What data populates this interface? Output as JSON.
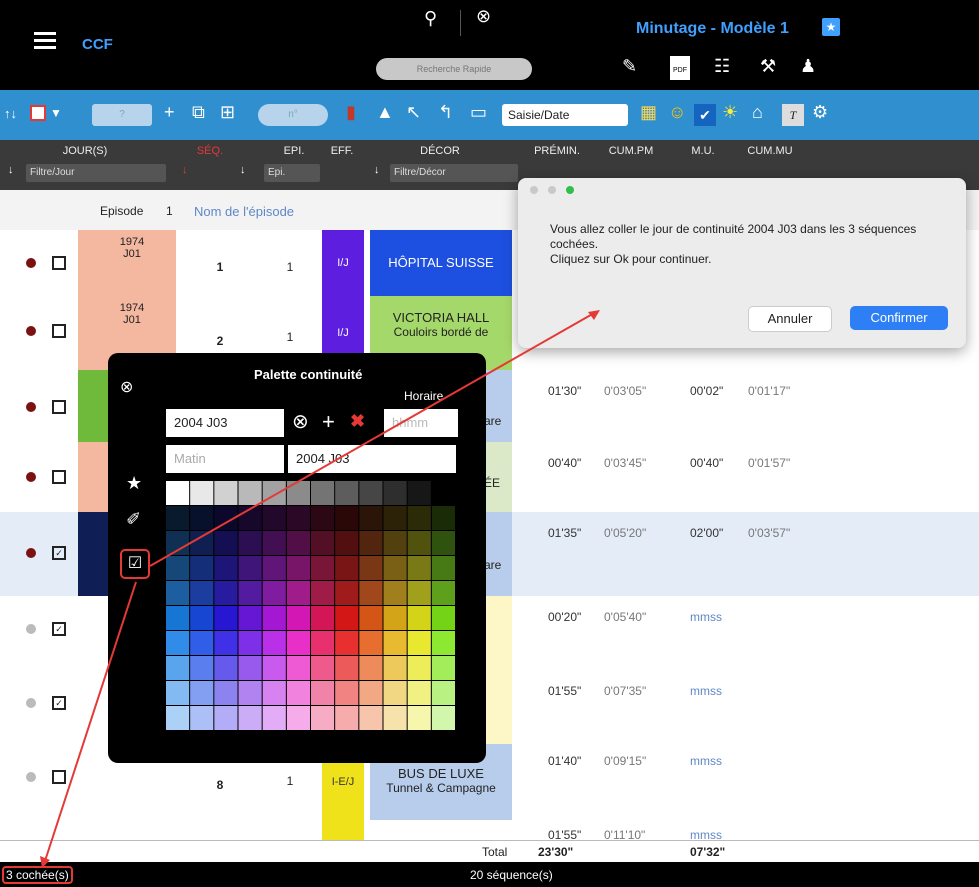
{
  "app": {
    "name": "CCF",
    "document_title": "Minutage - Modèle 1"
  },
  "search": {
    "placeholder": "Recherche Rapide"
  },
  "toolbar": {
    "saisie_label": "Saisie/Date",
    "episode_field": "?",
    "no_field": "n°"
  },
  "columns": {
    "jour": "JOUR(S)",
    "jour_filter": "Filtre/Jour",
    "seq": "SÉQ.",
    "epi": "EPI.",
    "epi_filter": "Epi.",
    "eff": "EFF.",
    "decor": "DÉCOR",
    "decor_filter": "Filtre/Décor",
    "premin": "PRÉMIN.",
    "cumpm": "CUM.PM",
    "mu": "M.U.",
    "cummu": "CUM.MU"
  },
  "episode": {
    "label": "Episode",
    "number": "1",
    "name_placeholder": "Nom de l'épisode"
  },
  "rows": [
    {
      "jour": "1974\nJ01",
      "seq": "1",
      "epi": "1",
      "eff": "I/J",
      "decor": "HÔPITAL SUISSE",
      "decor2": "",
      "premin": "",
      "cumpm": "",
      "mu": "",
      "cummu": ""
    },
    {
      "jour": "1974\nJ01",
      "seq": "2",
      "epi": "1",
      "eff": "I/J",
      "decor": "VICTORIA HALL",
      "decor2": "Couloirs bordé de",
      "premin": "",
      "cumpm": "",
      "mu": "",
      "cummu": ""
    },
    {
      "decor_tail": "are",
      "premin": "01'30\"",
      "cumpm": "0'03'05\"",
      "mu": "00'02\"",
      "cummu": "0'01'17\""
    },
    {
      "decor_tail": "ÉE",
      "premin": "00'40\"",
      "cumpm": "0'03'45\"",
      "mu": "00'40\"",
      "cummu": "0'01'57\""
    },
    {
      "decor_tail": "are",
      "premin": "01'35\"",
      "cumpm": "0'05'20\"",
      "mu": "02'00\"",
      "cummu": "0'03'57\""
    },
    {
      "premin": "00'20\"",
      "cumpm": "0'05'40\"",
      "mu": "mmss"
    },
    {
      "premin": "01'55\"",
      "cumpm": "0'07'35\"",
      "mu": "mmss"
    },
    {
      "seq": "8",
      "epi": "1",
      "eff": "I-E/J",
      "decor": "BUS DE LUXE",
      "decor2": "Tunnel & Campagne",
      "premin": "01'40\"",
      "cumpm": "0'09'15\"",
      "mu": "mmss"
    },
    {
      "premin": "01'55\"",
      "cumpm": "0'11'10\"",
      "mu": "mmss"
    }
  ],
  "totals": {
    "label": "Total",
    "premin": "23'30\"",
    "mu": "07'32\""
  },
  "status": {
    "checked": "3 cochée(s)",
    "sequences": "20 séquence(s)"
  },
  "palette": {
    "title": "Palette continuité",
    "horaire_label": "Horaire",
    "horaire_placeholder": "hhmm",
    "day_value": "2004 J03",
    "moment_placeholder": "Matin",
    "preview": "2004 J03"
  },
  "dialog": {
    "message": "Vous allez coller le jour de continuité 2004 J03 dans les 3 séquences cochées.\nCliquez sur Ok pour continuer.",
    "cancel": "Annuler",
    "confirm": "Confirmer"
  },
  "colors": {
    "accent": "#3fa0ff",
    "toolbar": "#2f8fcf",
    "confirm": "#2e7ff6",
    "annotation": "#e53935"
  }
}
